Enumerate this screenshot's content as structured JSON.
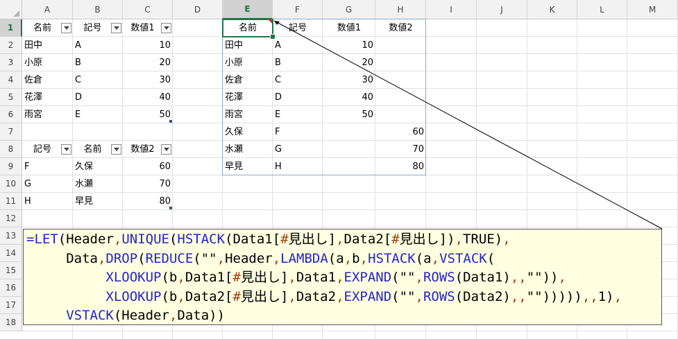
{
  "sheet": {
    "columns": [
      "A",
      "B",
      "C",
      "D",
      "E",
      "F",
      "G",
      "H",
      "I",
      "J",
      "K",
      "L",
      "M"
    ],
    "rows": [
      "1",
      "2",
      "3",
      "4",
      "5",
      "6",
      "7",
      "8",
      "9",
      "10",
      "11",
      "12",
      "13",
      "14",
      "15",
      "16",
      "17",
      "18"
    ],
    "selected_column": "E",
    "selected_row": "1"
  },
  "table1": {
    "headers": [
      "名前",
      "記号",
      "数値1"
    ],
    "rows": [
      [
        "田中",
        "A",
        "10"
      ],
      [
        "小原",
        "B",
        "20"
      ],
      [
        "佐倉",
        "C",
        "30"
      ],
      [
        "花澤",
        "D",
        "40"
      ],
      [
        "雨宮",
        "E",
        "50"
      ]
    ]
  },
  "table2": {
    "headers": [
      "記号",
      "名前",
      "数値2"
    ],
    "rows": [
      [
        "F",
        "久保",
        "60"
      ],
      [
        "G",
        "水瀬",
        "70"
      ],
      [
        "H",
        "早見",
        "80"
      ]
    ]
  },
  "result": {
    "headers": [
      "名前",
      "記号",
      "数値1",
      "数値2"
    ],
    "rows": [
      [
        "田中",
        "A",
        "10",
        ""
      ],
      [
        "小原",
        "B",
        "20",
        ""
      ],
      [
        "佐倉",
        "C",
        "30",
        ""
      ],
      [
        "花澤",
        "D",
        "40",
        ""
      ],
      [
        "雨宮",
        "E",
        "50",
        ""
      ],
      [
        "久保",
        "F",
        "",
        "60"
      ],
      [
        "水瀬",
        "G",
        "",
        "70"
      ],
      [
        "早見",
        "H",
        "",
        "80"
      ]
    ]
  },
  "formula_note": {
    "lines": [
      "=LET(Header,UNIQUE(HSTACK(Data1[#見出し],Data2[#見出し]),TRUE),",
      "     Data,DROP(REDUCE(\"\",Header,LAMBDA(a,b,HSTACK(a,VSTACK(",
      "          XLOOKUP(b,Data1[#見出し],Data1,EXPAND(\"\",ROWS(Data1),,\"\")),",
      "          XLOOKUP(b,Data2[#見出し],Data2,EXPAND(\"\",ROWS(Data2),,\"\"))))),,1),",
      "     VSTACK(Header,Data))"
    ]
  },
  "colors": {
    "function": "#2323d0",
    "separator": "#a04010",
    "selection": "#217346",
    "table_border": "#8ea9c8",
    "note_background": "#ffffe1"
  }
}
